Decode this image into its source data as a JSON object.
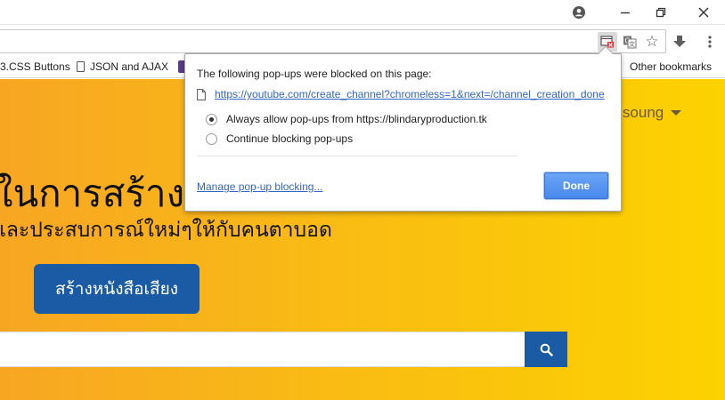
{
  "bookmarks": {
    "items": [
      {
        "label": "3.CSS Buttons"
      },
      {
        "label": "JSON and AJAX"
      },
      {
        "label": ""
      }
    ],
    "other": "Other bookmarks"
  },
  "omnibox": {
    "icons": [
      "popup-blocked-icon",
      "translate-icon",
      "star-icon"
    ]
  },
  "toolbar": {
    "icons": [
      "download-icon",
      "menu-icon"
    ]
  },
  "window": {
    "icons": [
      "account-icon",
      "minimize-icon",
      "restore-icon",
      "close-icon"
    ]
  },
  "popup": {
    "title": "The following pop-ups were blocked on this page:",
    "blocked_url": "https://youtube.com/create_channel?chromeless=1&next=/channel_creation_done",
    "options": [
      {
        "label": "Always allow pop-ups from https://blindaryproduction.tk",
        "selected": true
      },
      {
        "label": "Continue blocking pop-ups",
        "selected": false
      }
    ],
    "manage_link": "Manage pop-up blocking...",
    "done_label": "Done"
  },
  "page": {
    "user_name": "ensoung",
    "hero_title": "ในการสร้างห",
    "hero_subtitle": "และประสบการณ์ใหม่ๆให้กับคนตาบอด",
    "cta_label": "สร้างหนังสือเสียง",
    "search": {
      "value": "",
      "placeholder": ""
    },
    "colors": {
      "accent": "#1b5ba6",
      "background_start": "#f7a623",
      "background_end": "#fcd200"
    }
  }
}
